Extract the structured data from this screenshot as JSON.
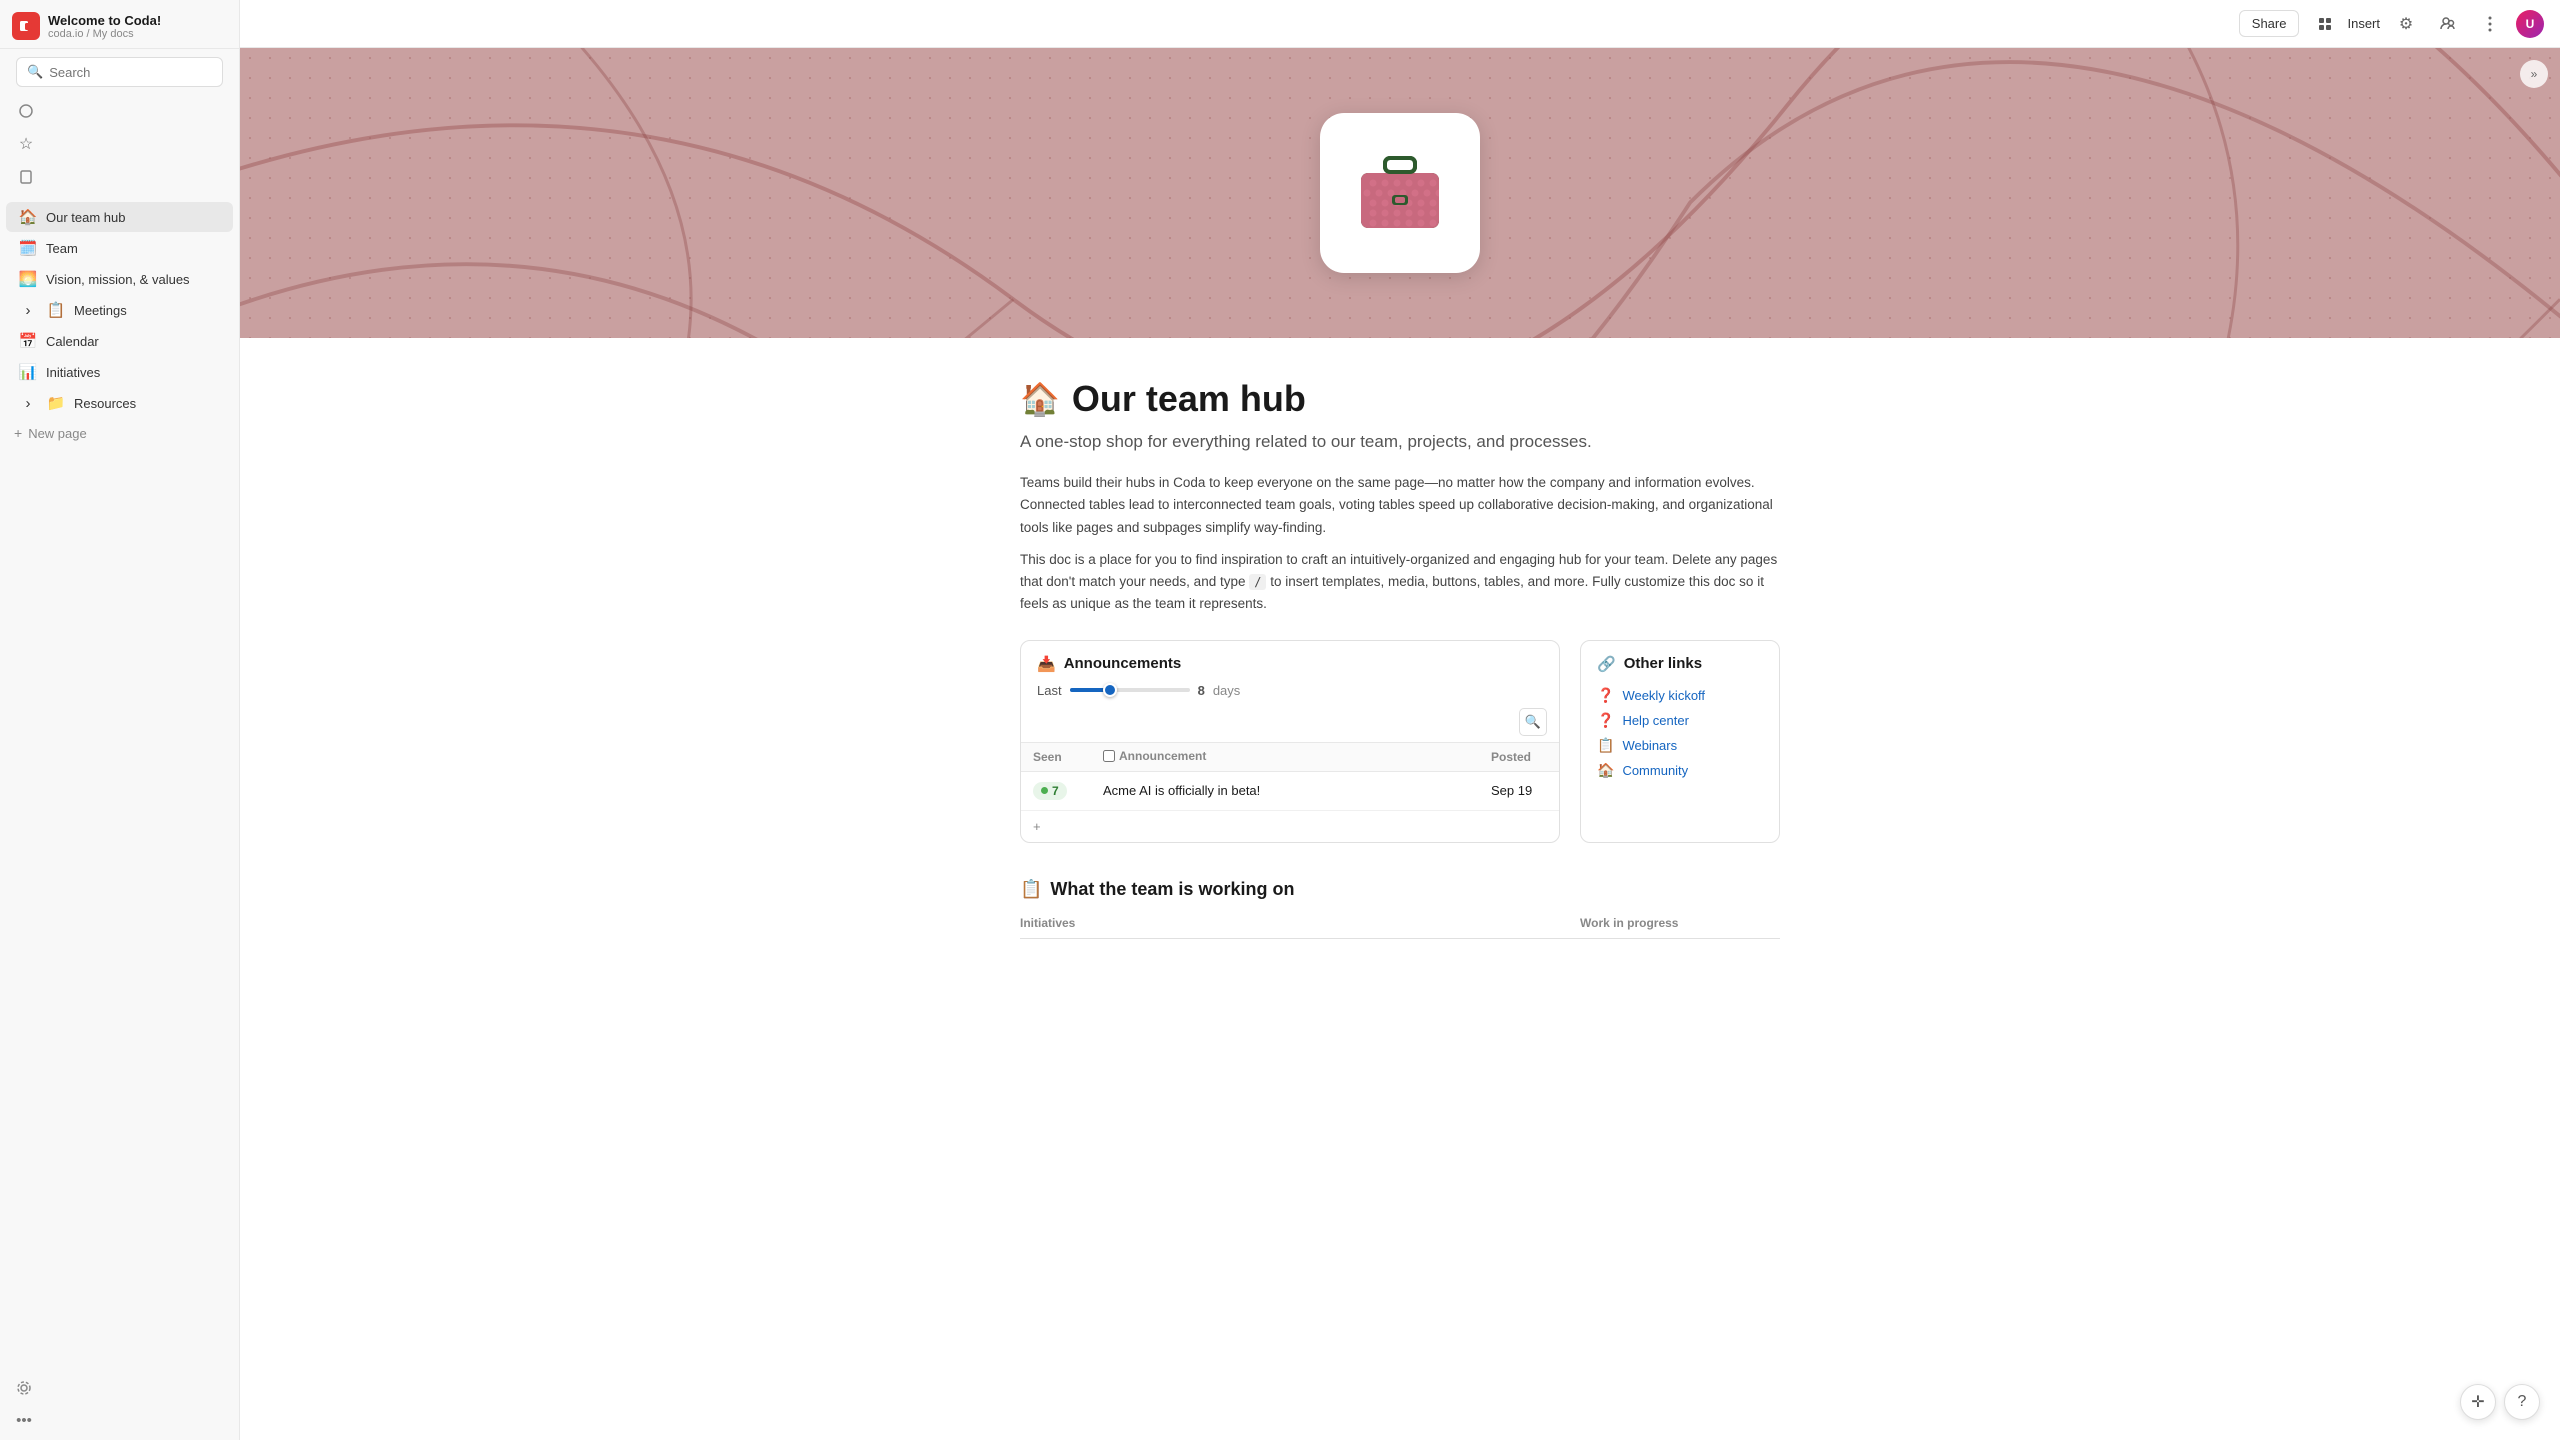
{
  "app": {
    "title": "Welcome to Coda!",
    "breadcrumb": "coda.io / My docs",
    "logo_text": "C"
  },
  "topbar": {
    "share_label": "Share",
    "insert_label": "Insert"
  },
  "sidebar": {
    "search_placeholder": "Search",
    "items": [
      {
        "id": "our-team-hub",
        "label": "Our team hub",
        "emoji": "🏠",
        "active": true,
        "expandable": false
      },
      {
        "id": "team",
        "label": "Team",
        "emoji": "🗓️",
        "active": false,
        "expandable": false
      },
      {
        "id": "vision-mission",
        "label": "Vision, mission, & values",
        "emoji": "🌅",
        "active": false,
        "expandable": false
      },
      {
        "id": "meetings",
        "label": "Meetings",
        "emoji": "📋",
        "active": false,
        "expandable": true
      },
      {
        "id": "calendar",
        "label": "Calendar",
        "emoji": "📅",
        "active": false,
        "expandable": false
      },
      {
        "id": "initiatives",
        "label": "Initiatives",
        "emoji": "📊",
        "active": false,
        "expandable": false
      },
      {
        "id": "resources",
        "label": "Resources",
        "emoji": "📁",
        "active": false,
        "expandable": true
      }
    ],
    "new_page_label": "New page"
  },
  "page": {
    "emoji": "🏠",
    "title": "Our team hub",
    "subtitle": "A one-stop shop for everything related to our team, projects, and processes.",
    "body_text_1": "Teams build their hubs in Coda to keep everyone on the same page—no matter how the company and information evolves. Connected tables lead to interconnected team goals, voting tables speed up collaborative decision-making, and organizational tools like pages and subpages simplify way-finding.",
    "body_text_2": "This doc is a place for you to find inspiration to craft an intuitively-organized and engaging hub for your team. Delete any pages that don't match your needs, and type / to insert templates, media, buttons, tables, and more.  Fully customize this doc so it feels as unique as the team it represents."
  },
  "announcements": {
    "header_emoji": "📥",
    "header_label": "Announcements",
    "slider_label_before": "Last",
    "slider_value": "8",
    "slider_unit": "days",
    "table_headers": [
      "Seen",
      "Announcement",
      "Posted"
    ],
    "rows": [
      {
        "seen_count": "7",
        "announcement": "Acme AI is officially in beta!",
        "posted": "Sep 19"
      }
    ]
  },
  "other_links": {
    "header_emoji": "🔗",
    "header_label": "Other links",
    "links": [
      {
        "emoji": "❓",
        "label": "Weekly kickoff"
      },
      {
        "emoji": "❓",
        "label": "Help center"
      },
      {
        "emoji": "📋",
        "label": "Webinars"
      },
      {
        "emoji": "🏠",
        "label": "Community"
      }
    ]
  },
  "working_on": {
    "emoji": "📋",
    "title": "What the team is working on",
    "col1": "Initiatives",
    "col2": "Work in progress"
  },
  "icons": {
    "search": "🔍",
    "star": "☆",
    "clock": "🕐",
    "pages": "📄",
    "expand_left": "«",
    "expand_right": "»",
    "chevron_right": "›",
    "settings": "⚙",
    "share_icon": "↑",
    "insert_icon": "⊞",
    "more": "•••",
    "help": "?",
    "plus": "+",
    "arrow_right": "→"
  }
}
